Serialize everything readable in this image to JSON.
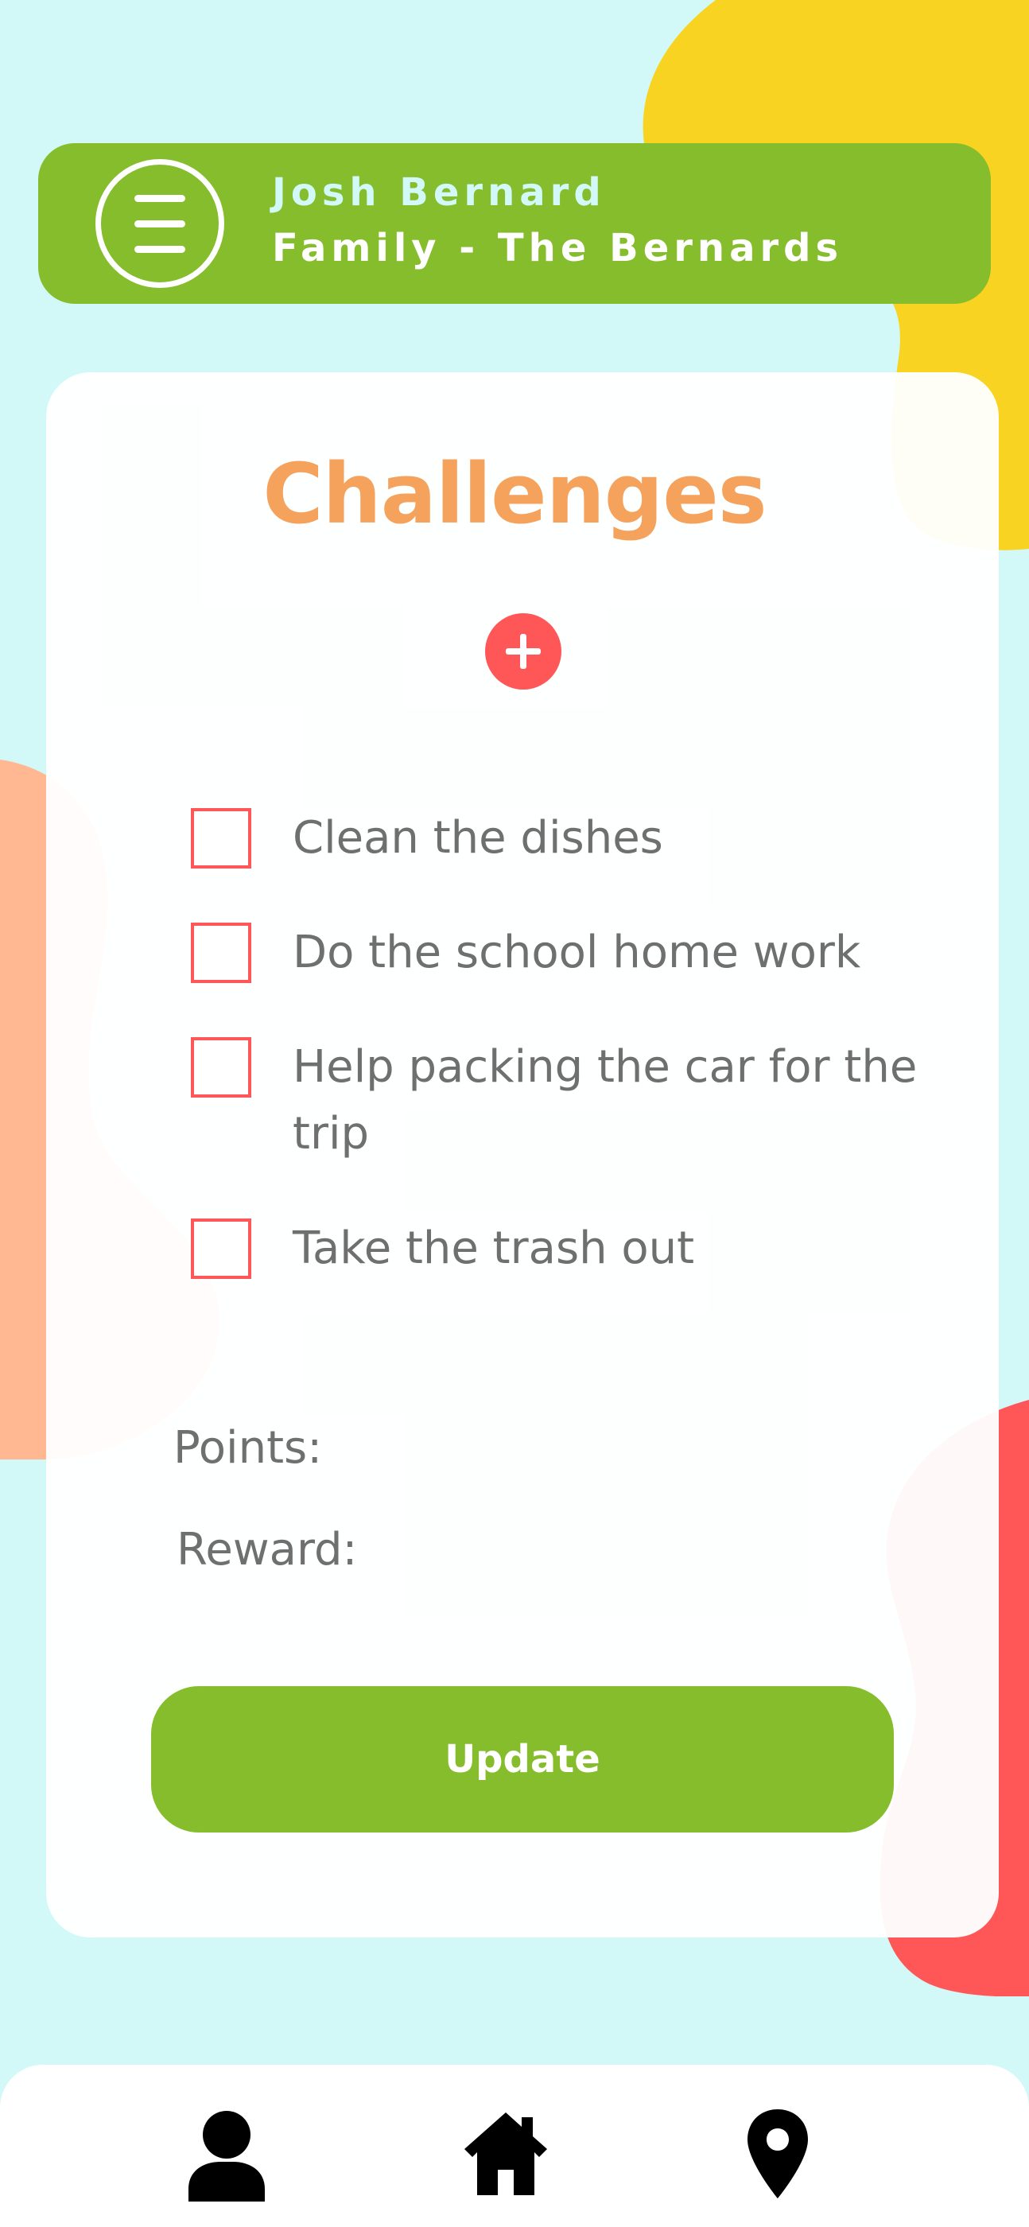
{
  "header": {
    "user_name": "Josh Bernard",
    "family_name": "Family - The Bernards",
    "menu_icon": "hamburger-menu-icon"
  },
  "card": {
    "title": "Challenges",
    "add_icon": "plus-icon",
    "challenges": [
      {
        "label": "Clean the dishes",
        "checked": false
      },
      {
        "label": "Do the school home work",
        "checked": false
      },
      {
        "label": "Help packing the car for the trip",
        "checked": false
      },
      {
        "label": "Take the trash out",
        "checked": false
      }
    ],
    "points_label": "Points:",
    "reward_label": "Reward:",
    "update_label": "Update"
  },
  "bottom_nav": {
    "items": [
      {
        "icon": "user-icon"
      },
      {
        "icon": "home-icon"
      },
      {
        "icon": "map-pin-icon"
      }
    ]
  },
  "colors": {
    "background": "#d2f9f8",
    "primary_green": "#86bd2c",
    "accent_red": "#ff5757",
    "title_orange": "#f5a25d",
    "blob_yellow": "#f8d322",
    "blob_peach": "#ffb892",
    "text_gray": "#6f6f6f"
  }
}
